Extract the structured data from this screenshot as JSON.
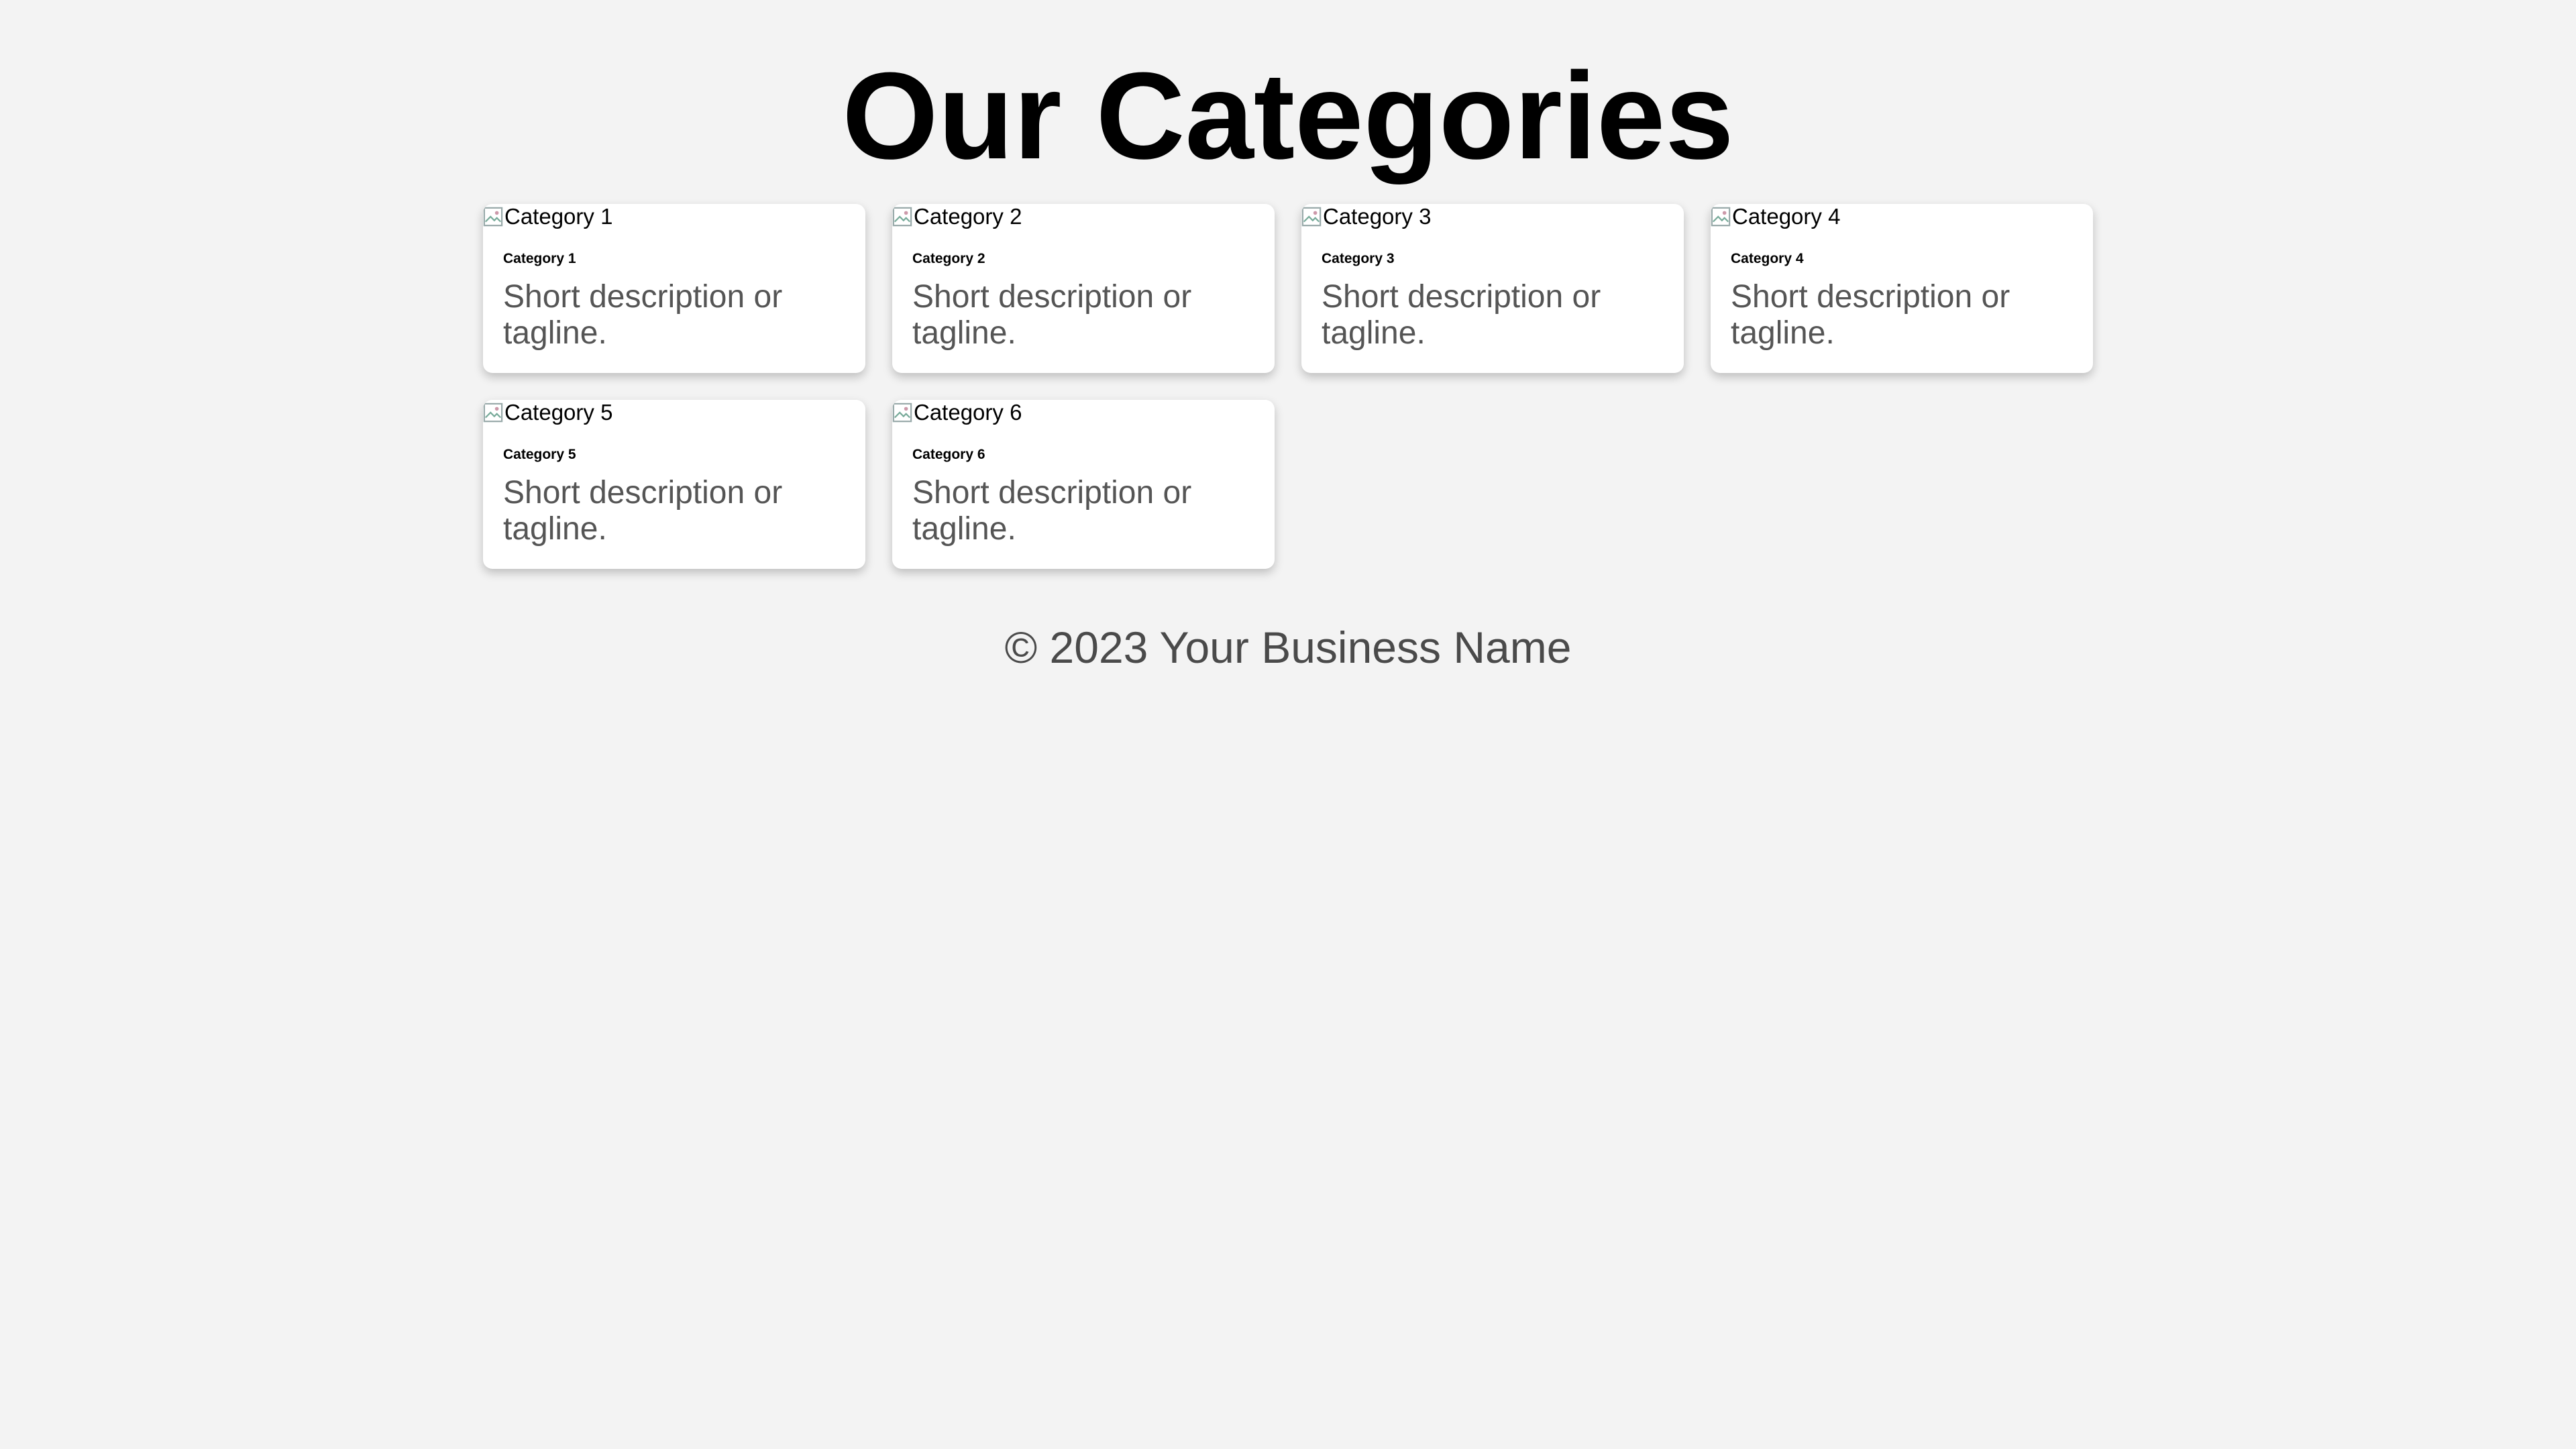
{
  "header": {
    "title": "Our Categories"
  },
  "categories": [
    {
      "image_alt": "Category 1",
      "title": "Category 1",
      "description": "Short description or tagline."
    },
    {
      "image_alt": "Category 2",
      "title": "Category 2",
      "description": "Short description or tagline."
    },
    {
      "image_alt": "Category 3",
      "title": "Category 3",
      "description": "Short description or tagline."
    },
    {
      "image_alt": "Category 4",
      "title": "Category 4",
      "description": "Short description or tagline."
    },
    {
      "image_alt": "Category 5",
      "title": "Category 5",
      "description": "Short description or tagline."
    },
    {
      "image_alt": "Category 6",
      "title": "Category 6",
      "description": "Short description or tagline."
    }
  ],
  "footer": {
    "text": "© 2023 Your Business Name"
  },
  "colors": {
    "background": "#f3f3f3",
    "card": "#ffffff",
    "description_text": "#555555",
    "footer_text": "#4a4a4a"
  },
  "icons": {
    "card_image": "broken-image-icon"
  }
}
